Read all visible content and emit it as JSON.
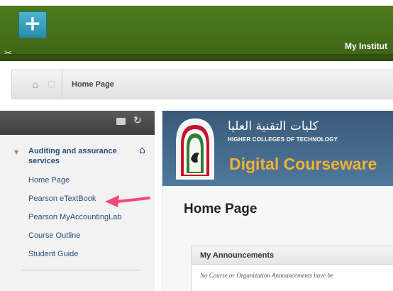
{
  "header": {
    "add_icon": "+",
    "pin_icon": "pin-icon",
    "institution_label": "My Institut"
  },
  "breadcrumb": {
    "home_icon": "⌂",
    "separator_icon": "○",
    "current": "Home Page"
  },
  "course_menu": {
    "course_title": "Auditing and assurance services",
    "items": [
      "Home Page",
      "Pearson eTextBook",
      "Pearson MyAccountingLab",
      "Course Outline",
      "Student Guide"
    ],
    "highlight_color": "#ee4a7a"
  },
  "banner": {
    "arabic_name": "كليات التقنية العليا",
    "english_name": "HIGHER COLLEGES OF TECHNOLOGY",
    "product_name": "Digital Courseware"
  },
  "main": {
    "page_title": "Home Page",
    "announcements_title": "My Announcements",
    "announcements_empty": "No Course or Organization Announcements have be"
  }
}
